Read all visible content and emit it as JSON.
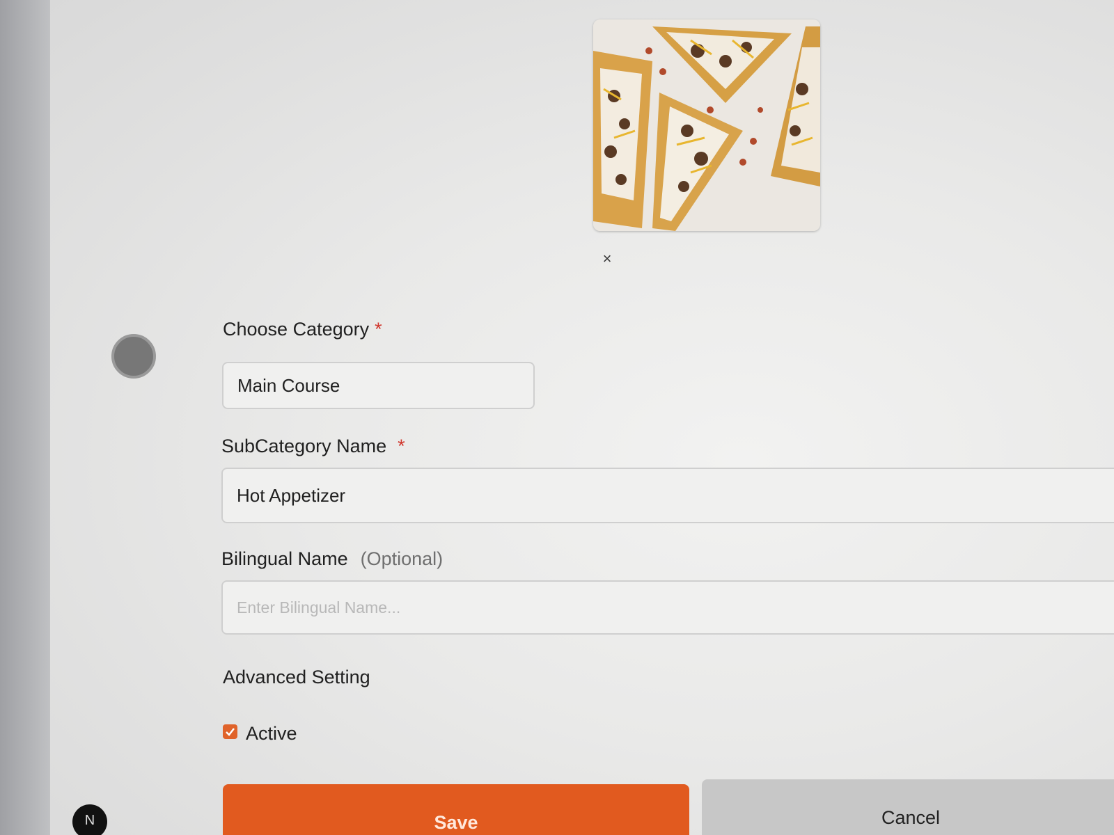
{
  "image": {
    "remove_icon": "×"
  },
  "form": {
    "category": {
      "label": "Choose Category",
      "required_mark": "*",
      "value": "Main Course"
    },
    "subcategory": {
      "label": "SubCategory Name",
      "required_mark": "*",
      "value": "Hot Appetizer"
    },
    "bilingual": {
      "label": "Bilingual Name",
      "optional_note": "(Optional)",
      "placeholder": "Enter Bilingual Name..."
    },
    "advanced": {
      "heading": "Advanced Setting",
      "active_label": "Active",
      "active_checked": true
    },
    "actions": {
      "save_label": "Save",
      "cancel_label": "Cancel"
    }
  },
  "misc": {
    "corner_badge": "N"
  },
  "colors": {
    "accent": "#e15a1f",
    "required": "#d0352b"
  }
}
